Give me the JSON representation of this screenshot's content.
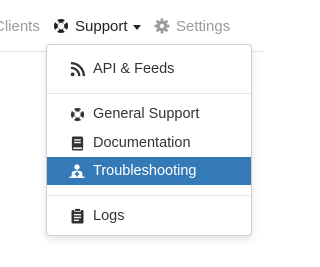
{
  "nav": {
    "clients": "Clients",
    "support": "Support",
    "settings": "Settings"
  },
  "dropdown": {
    "items": [
      {
        "label": "API & Feeds",
        "icon": "rss-icon"
      },
      {
        "label": "General Support",
        "icon": "lifebuoy-icon"
      },
      {
        "label": "Documentation",
        "icon": "book-icon"
      },
      {
        "label": "Troubleshooting",
        "icon": "medic-icon",
        "active": true
      },
      {
        "label": "Logs",
        "icon": "clipboard-icon"
      }
    ]
  },
  "colors": {
    "active_bg": "#337ab7",
    "muted_text": "#9b9b9b",
    "text": "#333333"
  }
}
